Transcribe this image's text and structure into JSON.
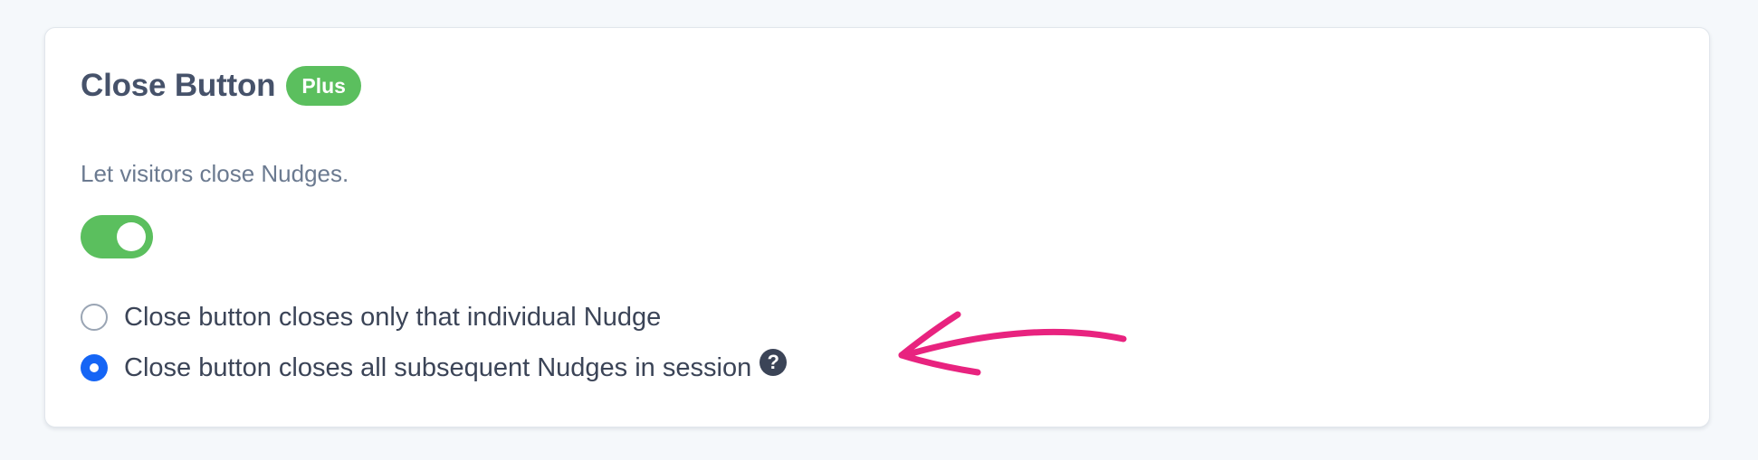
{
  "section": {
    "title": "Close Button",
    "badge": "Plus",
    "description": "Let visitors close Nudges."
  },
  "toggle": {
    "enabled": true
  },
  "options": [
    {
      "label": "Close button closes only that individual Nudge",
      "selected": false
    },
    {
      "label": "Close button closes all subsequent Nudges in session",
      "selected": true
    }
  ],
  "help_icon": {
    "glyph": "?",
    "icon": "question-circle-icon"
  },
  "annotation": {
    "icon": "hand-drawn-arrow",
    "color": "#e8237f"
  },
  "colors": {
    "accent_green": "#5bbf5e",
    "radio_blue": "#1565f5"
  }
}
